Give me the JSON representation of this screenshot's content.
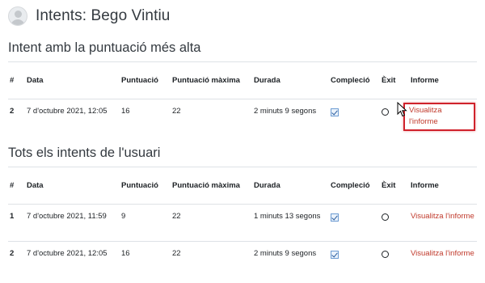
{
  "page": {
    "title": "Intents: Bego Vintiu"
  },
  "best_attempt": {
    "title": "Intent amb la puntuació més alta",
    "columns": [
      "#",
      "Data",
      "Puntuació",
      "Puntuació màxima",
      "Durada",
      "Compleció",
      "Èxit",
      "Informe"
    ],
    "rows": [
      {
        "num": "2",
        "date": "7 d'octubre 2021, 12:05",
        "score": "16",
        "max_score": "22",
        "duration": "2 minuts 9 segons",
        "completion": true,
        "success": false,
        "report": "Visualitza l'informe"
      }
    ]
  },
  "all_attempts": {
    "title": "Tots els intents de l'usuari",
    "columns": [
      "#",
      "Data",
      "Puntuació",
      "Puntuació màxima",
      "Durada",
      "Compleció",
      "Èxit",
      "Informe"
    ],
    "rows": [
      {
        "num": "1",
        "date": "7 d'octubre 2021, 11:59",
        "score": "9",
        "max_score": "22",
        "duration": "1 minuts 13 segons",
        "completion": true,
        "success": false,
        "report": "Visualitza l'informe"
      },
      {
        "num": "2",
        "date": "7 d'octubre 2021, 12:05",
        "score": "16",
        "max_score": "22",
        "duration": "2 minuts 9 segons",
        "completion": true,
        "success": false,
        "report": "Visualitza l'informe"
      }
    ]
  },
  "colors": {
    "link": "#c0392b",
    "highlight": "#d0222b",
    "checkbox": "#2a5d9f"
  },
  "icons": {
    "avatar": "user-avatar-icon",
    "completion": "checkbox-checked-icon",
    "success": "circle-outline-icon",
    "cursor": "mouse-pointer-icon"
  }
}
